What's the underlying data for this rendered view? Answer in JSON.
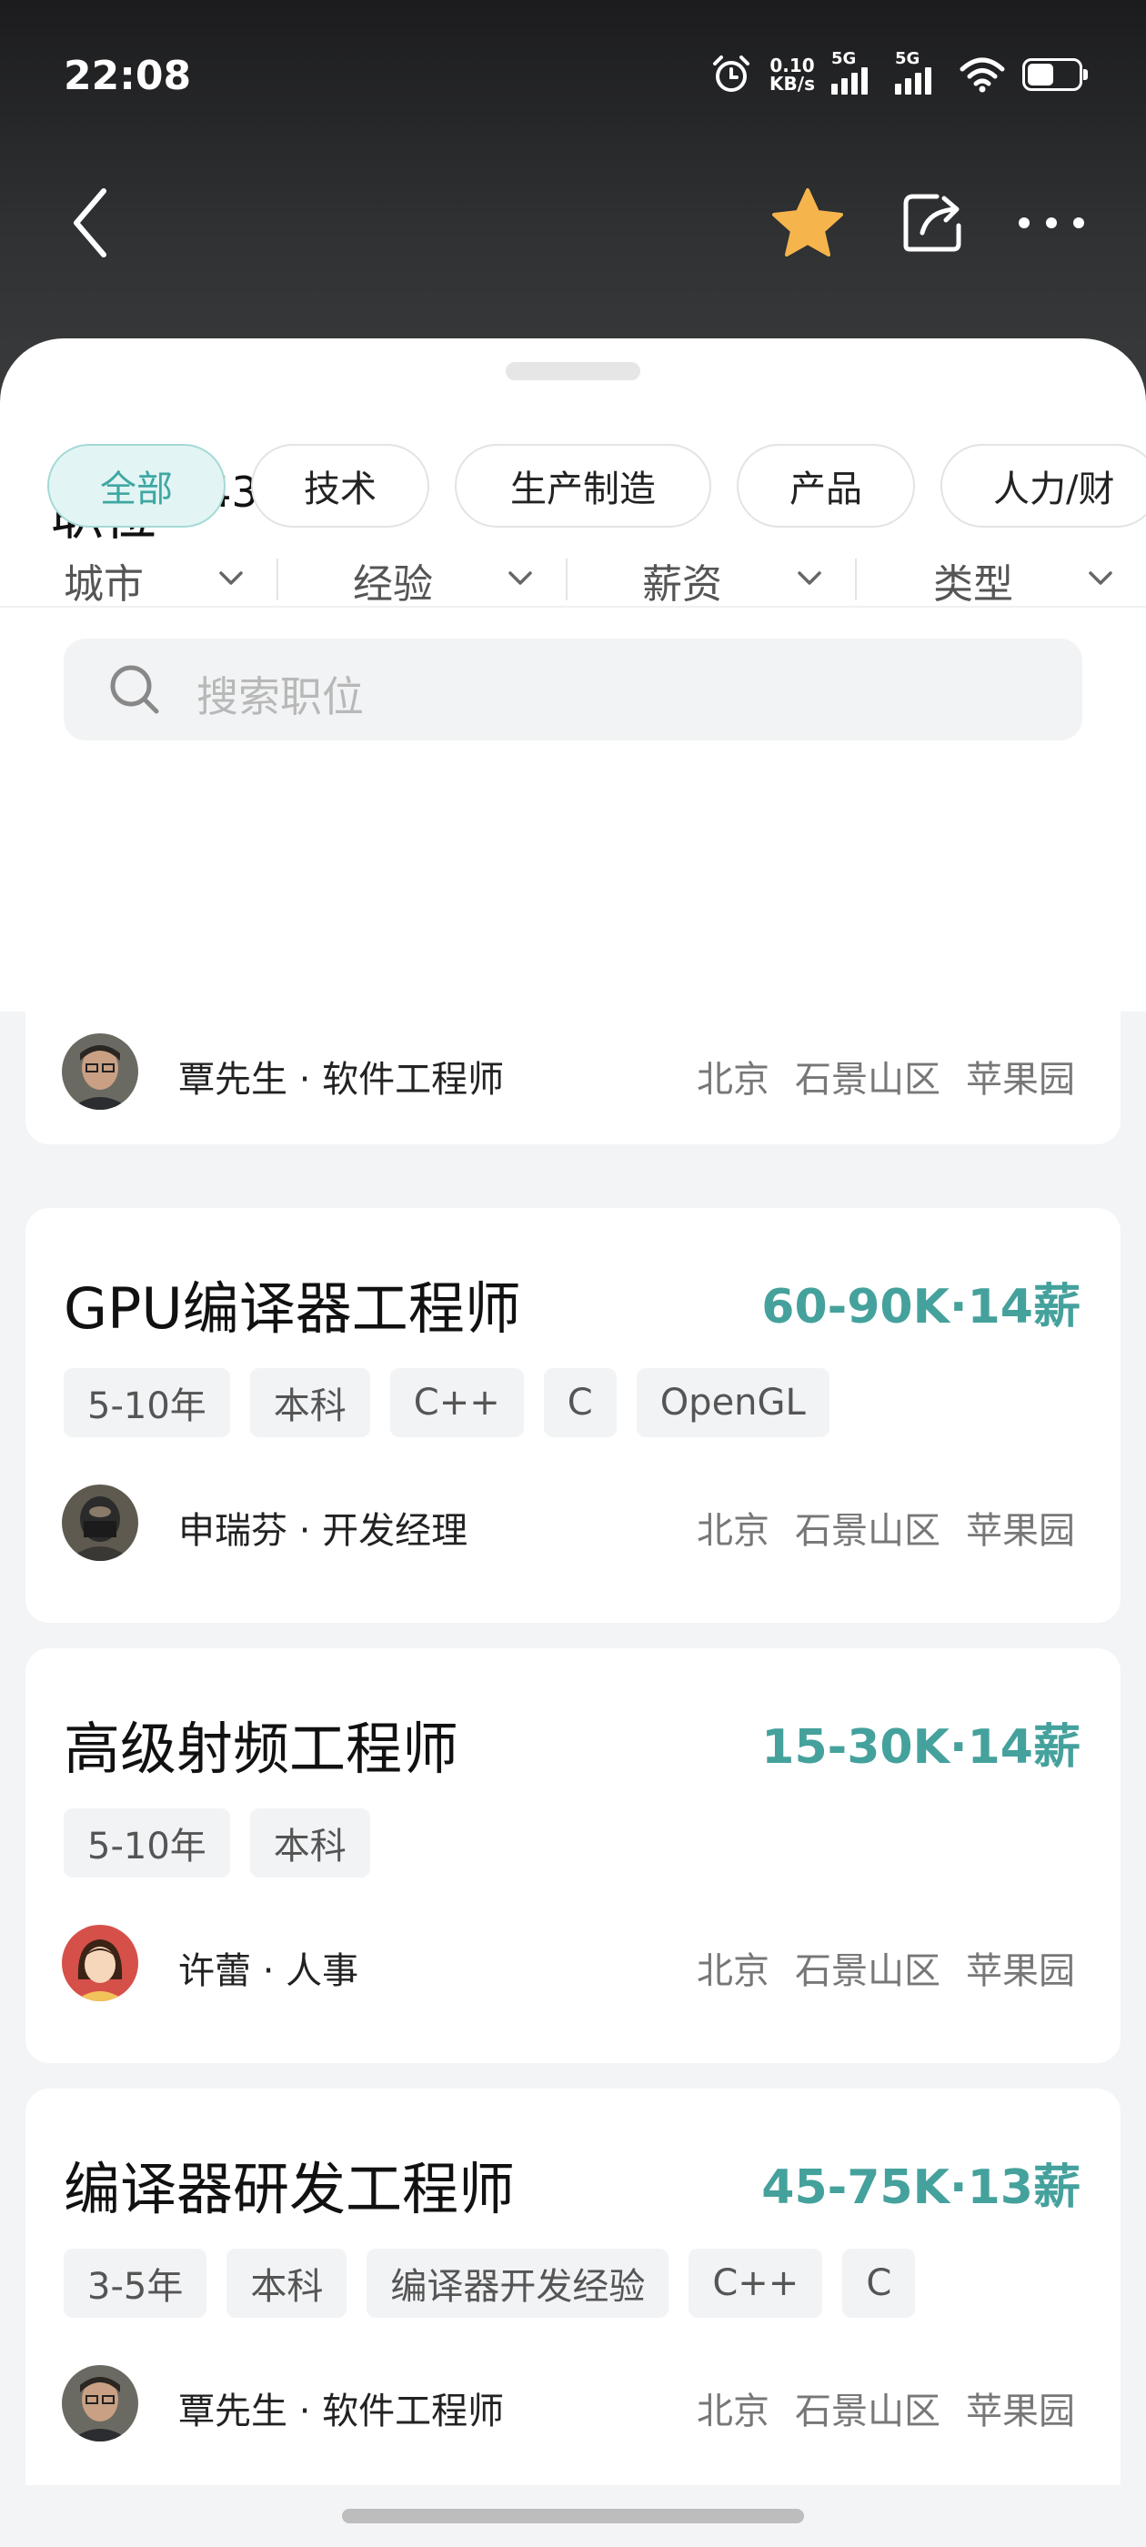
{
  "status_bar": {
    "time": "22:08",
    "net_speed_value": "0.10",
    "net_speed_unit": "KB/s",
    "signal1_label": "5G",
    "signal2_label": "5G",
    "battery_level": 0.5
  },
  "nav": {
    "back_icon": "chevron-left-icon",
    "favorite_icon": "star-icon",
    "favorite_color": "#F5B54C",
    "share_icon": "share-icon",
    "more_icon": "more-dots-icon"
  },
  "header": {
    "title": "职位",
    "count": "343"
  },
  "search": {
    "placeholder": "搜索职位"
  },
  "categories": [
    {
      "label": "全部",
      "active": true
    },
    {
      "label": "技术",
      "active": false
    },
    {
      "label": "生产制造",
      "active": false
    },
    {
      "label": "产品",
      "active": false
    },
    {
      "label": "人力/财",
      "active": false
    }
  ],
  "filters": [
    {
      "label": "城市"
    },
    {
      "label": "经验"
    },
    {
      "label": "薪资"
    },
    {
      "label": "类型"
    }
  ],
  "accent_color": "#45A19C",
  "jobs": [
    {
      "recruiter": "覃先生 · 软件工程师",
      "city": "北京",
      "district": "石景山区",
      "area": "苹果园"
    },
    {
      "title": "GPU编译器工程师",
      "salary": "60-90K·14薪",
      "tags": [
        "5-10年",
        "本科",
        "C++",
        "C",
        "OpenGL"
      ],
      "recruiter": "申瑞芬 · 开发经理",
      "city": "北京",
      "district": "石景山区",
      "area": "苹果园"
    },
    {
      "title": "高级射频工程师",
      "salary": "15-30K·14薪",
      "tags": [
        "5-10年",
        "本科"
      ],
      "recruiter": "许蕾 · 人事",
      "city": "北京",
      "district": "石景山区",
      "area": "苹果园"
    },
    {
      "title": "编译器研发工程师",
      "salary": "45-75K·13薪",
      "tags": [
        "3-5年",
        "本科",
        "编译器开发经验",
        "C++",
        "C"
      ],
      "recruiter": "覃先生 · 软件工程师",
      "city": "北京",
      "district": "石景山区",
      "area": "苹果园"
    }
  ]
}
